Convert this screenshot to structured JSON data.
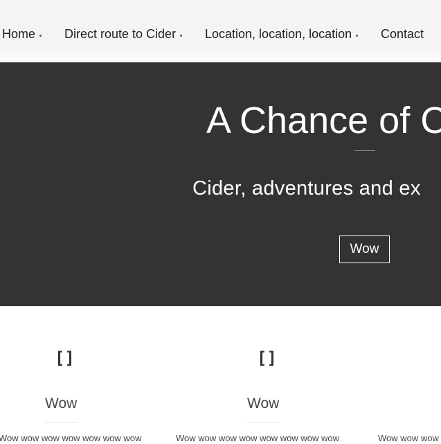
{
  "nav": {
    "items": [
      {
        "label": "Home",
        "has_submenu": true
      },
      {
        "label": "Direct route to Cider",
        "has_submenu": true
      },
      {
        "label": "Location, location, location",
        "has_submenu": true
      },
      {
        "label": "Contact",
        "has_submenu": false
      }
    ]
  },
  "hero": {
    "title": "A Chance of C",
    "subtitle": "Cider, adventures and ex",
    "button_label": "Wow"
  },
  "features": [
    {
      "icon": "[]",
      "icon_name": "placeholder-icon",
      "title": "Wow",
      "text": "Wow wow wow wow wow wow wow"
    },
    {
      "icon": "[]",
      "icon_name": "placeholder-icon",
      "title": "Wow",
      "text": "Wow wow wow wow wow wow wow wow"
    },
    {
      "icon": "",
      "icon_name": "placeholder-icon",
      "title": "",
      "text": "Wow wow wow"
    }
  ],
  "colors": {
    "nav_bg": "#f4f4f4",
    "hero_bg": "#333333",
    "hero_text": "#ffffff",
    "body_text": "#333333"
  }
}
